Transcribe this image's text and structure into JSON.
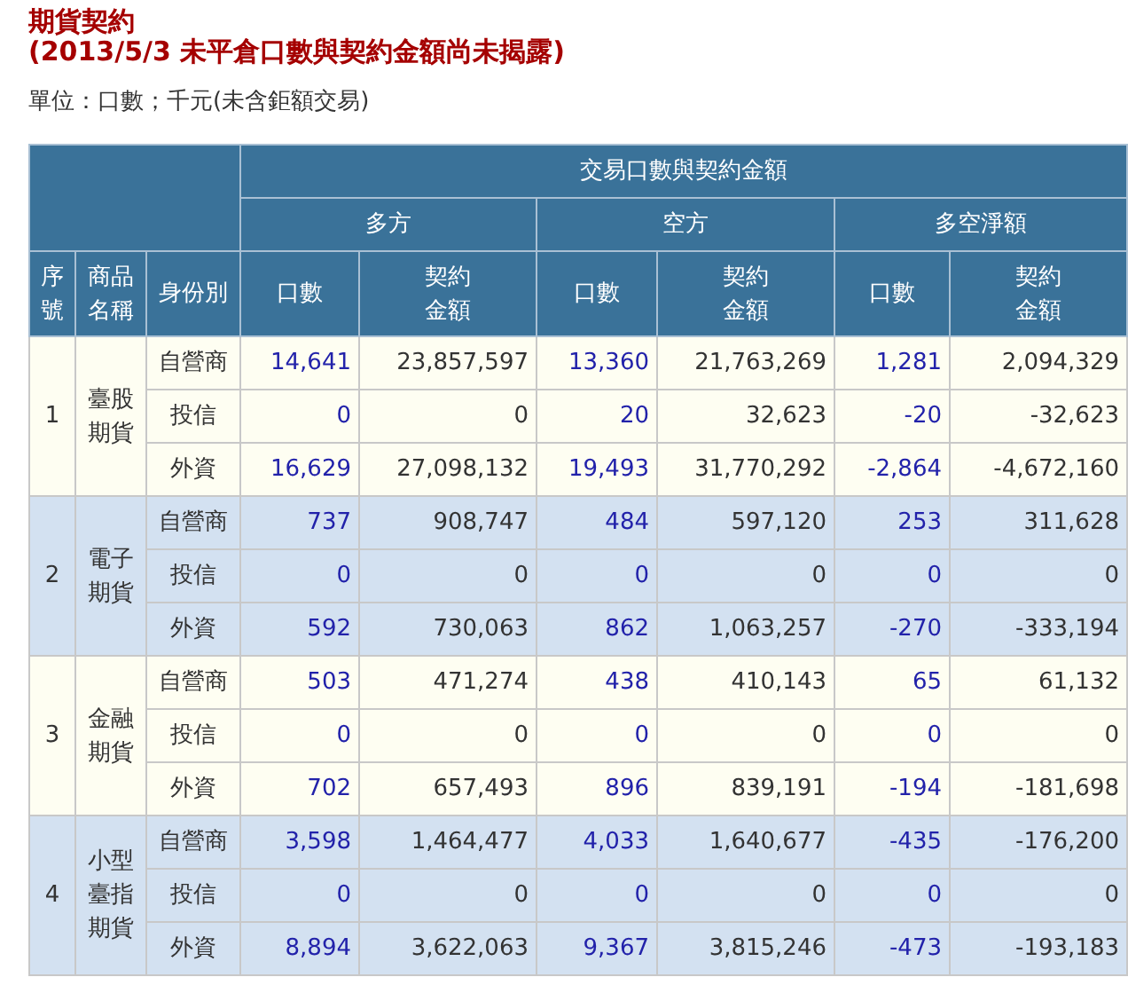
{
  "title": "期貨契約",
  "subtitle": "(2013/5/3 未平倉口數與契約金額尚未揭露)",
  "unit": "單位：口數；千元(未含鉅額交易)",
  "table": {
    "group_header": "交易口數與契約金額",
    "sides": [
      {
        "name": "多方",
        "sub_columns": [
          {
            "kind": "count",
            "label": [
              "口數"
            ]
          },
          {
            "kind": "amount",
            "label": [
              "契約",
              "金額"
            ]
          }
        ]
      },
      {
        "name": "空方",
        "sub_columns": [
          {
            "kind": "count",
            "label": [
              "口數"
            ]
          },
          {
            "kind": "amount",
            "label": [
              "契約",
              "金額"
            ]
          }
        ]
      },
      {
        "name": "多空淨額",
        "sub_columns": [
          {
            "kind": "count",
            "label": [
              "口數"
            ]
          },
          {
            "kind": "amount",
            "label": [
              "契約",
              "金額"
            ]
          }
        ]
      }
    ],
    "left_columns": [
      [
        "序",
        "號"
      ],
      [
        "商品",
        "名稱"
      ],
      [
        "身份別"
      ]
    ],
    "groups": [
      {
        "seq": "1",
        "product": "臺股期貨",
        "rows": [
          {
            "identity": "自營商",
            "values": [
              "14,641",
              "23,857,597",
              "13,360",
              "21,763,269",
              "1,281",
              "2,094,329"
            ]
          },
          {
            "identity": "投信",
            "values": [
              "0",
              "0",
              "20",
              "32,623",
              "-20",
              "-32,623"
            ]
          },
          {
            "identity": "外資",
            "values": [
              "16,629",
              "27,098,132",
              "19,493",
              "31,770,292",
              "-2,864",
              "-4,672,160"
            ]
          }
        ]
      },
      {
        "seq": "2",
        "product": "電子期貨",
        "rows": [
          {
            "identity": "自營商",
            "values": [
              "737",
              "908,747",
              "484",
              "597,120",
              "253",
              "311,628"
            ]
          },
          {
            "identity": "投信",
            "values": [
              "0",
              "0",
              "0",
              "0",
              "0",
              "0"
            ]
          },
          {
            "identity": "外資",
            "values": [
              "592",
              "730,063",
              "862",
              "1,063,257",
              "-270",
              "-333,194"
            ]
          }
        ]
      },
      {
        "seq": "3",
        "product": "金融期貨",
        "rows": [
          {
            "identity": "自營商",
            "values": [
              "503",
              "471,274",
              "438",
              "410,143",
              "65",
              "61,132"
            ]
          },
          {
            "identity": "投信",
            "values": [
              "0",
              "0",
              "0",
              "0",
              "0",
              "0"
            ]
          },
          {
            "identity": "外資",
            "values": [
              "702",
              "657,493",
              "896",
              "839,191",
              "-194",
              "-181,698"
            ]
          }
        ]
      },
      {
        "seq": "4",
        "product": "小型臺指期貨",
        "rows": [
          {
            "identity": "自營商",
            "values": [
              "3,598",
              "1,464,477",
              "4,033",
              "1,640,677",
              "-435",
              "-176,200"
            ]
          },
          {
            "identity": "投信",
            "values": [
              "0",
              "0",
              "0",
              "0",
              "0",
              "0"
            ]
          },
          {
            "identity": "外資",
            "values": [
              "8,894",
              "3,622,063",
              "9,367",
              "3,815,246",
              "-473",
              "-193,183"
            ]
          }
        ]
      }
    ]
  }
}
